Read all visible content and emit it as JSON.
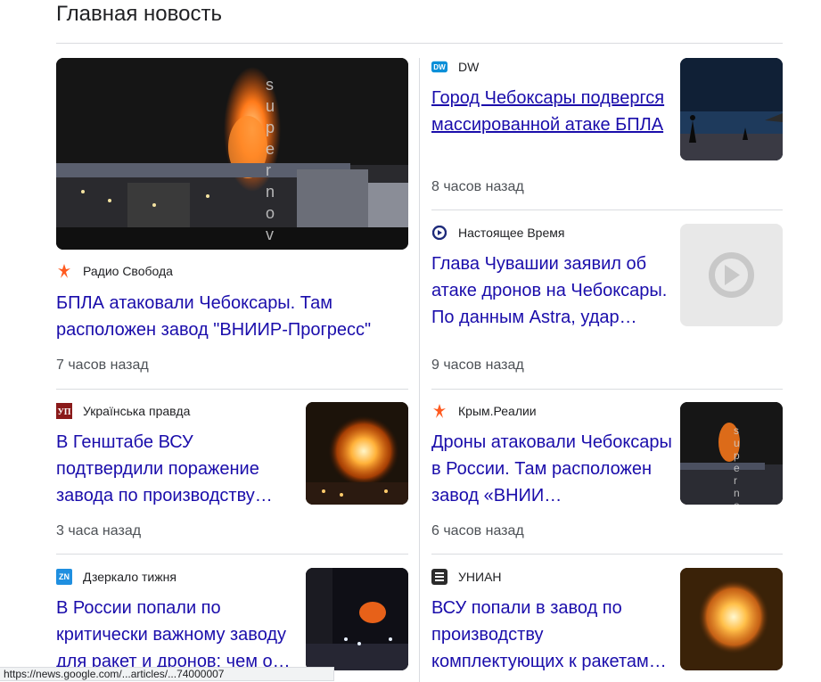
{
  "section_title": "Главная новость",
  "featured": {
    "source": "Радио Свобода",
    "source_icon": "radio-svoboda-logo",
    "headline": "БПЛА атаковали Чебоксары. Там расположен завод \"ВНИИР-Прогресс\"",
    "time": "7 часов назад",
    "watermark": "supernov"
  },
  "right_top": [
    {
      "source": "DW",
      "source_icon": "dw-logo",
      "headline": "Город Чебоксары подвергся массированной атаке БПЛА",
      "time": "8 часов назад"
    },
    {
      "source": "Настоящее Время",
      "source_icon": "current-time-logo",
      "headline": "Глава Чувашии заявил об атаке дронов на Чебоксары. По данным Astra, удар…",
      "time": "9 часов назад"
    }
  ],
  "left_list": [
    {
      "source": "Українська правда",
      "source_icon": "ukrainska-pravda-logo",
      "headline": "В Генштабе ВСУ подтвердили поражение завода по производству…",
      "time": "3 часа назад"
    },
    {
      "source": "Дзеркало тижня",
      "source_icon": "zn-logo",
      "source_icon_text": "ZN",
      "headline": "В России попали по критически важному заводу для ракет и дронов: чем о…",
      "time": ""
    }
  ],
  "right_list": [
    {
      "source": "Крым.Реалии",
      "source_icon": "krym-realii-logo",
      "headline": "Дроны атаковали Чебоксары в России. Там расположен завод «ВНИИ…",
      "time": "6 часов назад"
    },
    {
      "source": "УНИАН",
      "source_icon": "unian-logo",
      "headline": "ВСУ попали в завод по производству комплектующих к ракетам…",
      "time": ""
    }
  ],
  "status_url": "https://news.google.com/...articles/...74000007",
  "colors": {
    "link": "#1a0dab",
    "text": "#202124",
    "muted": "#4d5156",
    "divider": "#dadce0"
  }
}
